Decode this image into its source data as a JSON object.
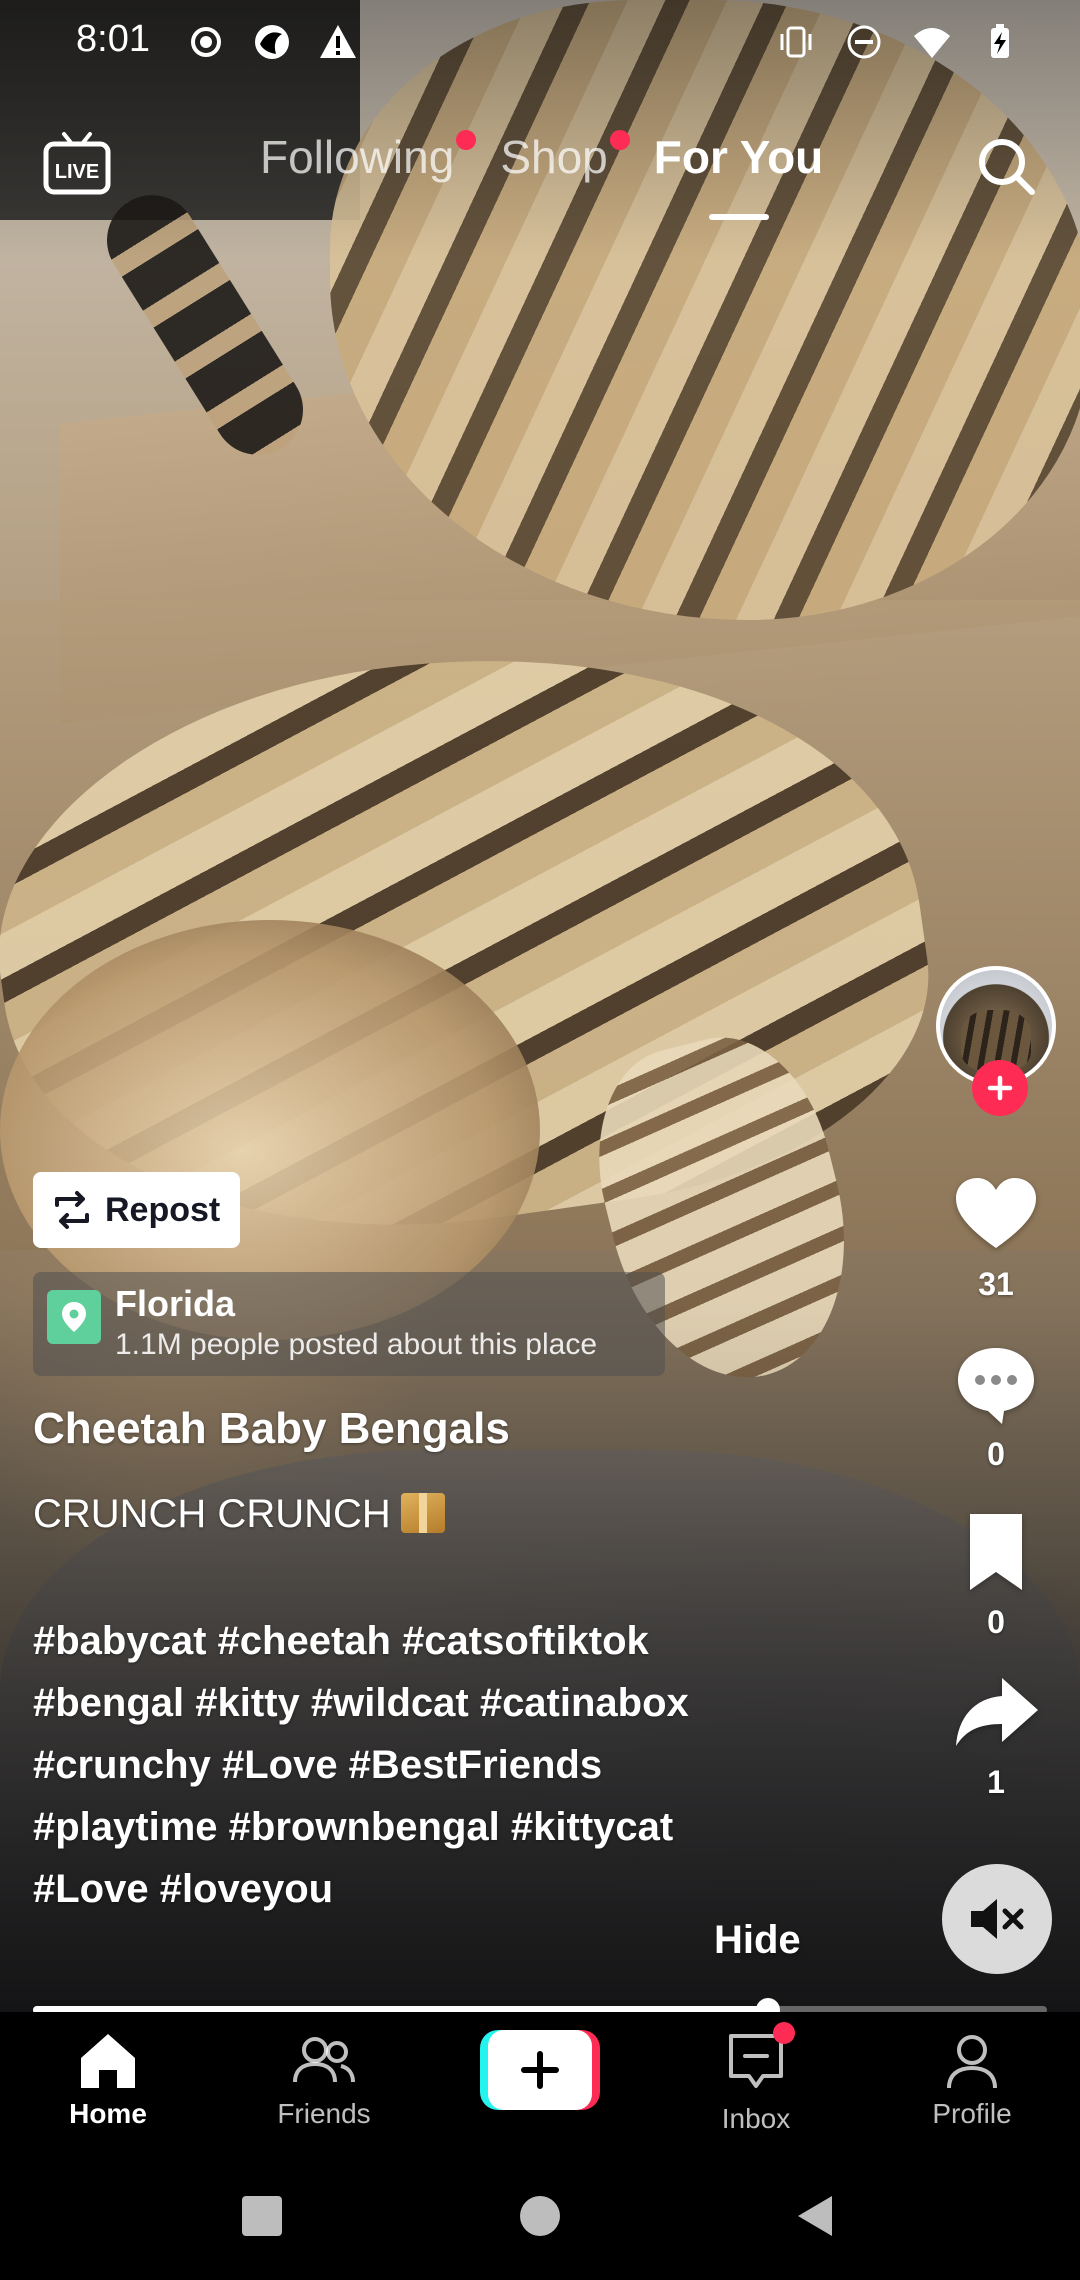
{
  "status_bar": {
    "time": "8:01",
    "left_icons": [
      "record-icon",
      "app-icon",
      "alert-icon"
    ],
    "right_icons": [
      "vibrate-icon",
      "dnd-icon",
      "wifi-icon",
      "battery-charging-icon"
    ]
  },
  "top_nav": {
    "live_label": "LIVE",
    "tabs": [
      {
        "label": "Following",
        "has_dot": true,
        "active": false
      },
      {
        "label": "Shop",
        "has_dot": true,
        "active": false
      },
      {
        "label": "For You",
        "has_dot": false,
        "active": true
      }
    ]
  },
  "rail": {
    "likes": "31",
    "comments": "0",
    "saves": "0",
    "shares": "1"
  },
  "post": {
    "repost_label": "Repost",
    "location_name": "Florida",
    "location_sub": "1.1M people posted about this place",
    "author": "Cheetah Baby Bengals",
    "description": "CRUNCH CRUNCH",
    "hashtag_lines": [
      "#babycat #cheetah #catsoftiktok",
      "#bengal #kitty #wildcat #catinabox",
      "#crunchy #Love #BestFriends",
      "#playtime #brownbengal #kittycat",
      "#Love #loveyou"
    ],
    "hide_label": "Hide",
    "progress_fraction": 0.725
  },
  "tabbar": {
    "home": "Home",
    "friends": "Friends",
    "inbox": "Inbox",
    "profile": "Profile"
  },
  "colors": {
    "accent": "#fe2c55",
    "create_cyan": "#25f4ee",
    "location_green": "#5fcf9c"
  }
}
